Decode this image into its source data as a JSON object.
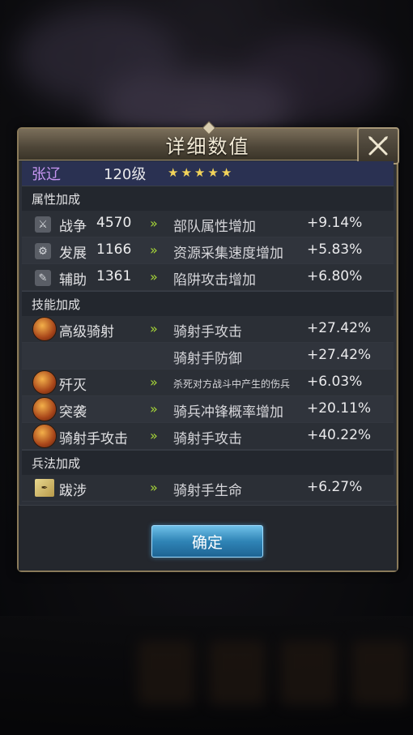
{
  "dialog": {
    "title": "详细数值",
    "confirm_label": "确定"
  },
  "hero": {
    "name": "张辽",
    "level": "120级",
    "stars": [
      "★",
      "★",
      "★",
      "★",
      "★"
    ]
  },
  "attr_section": {
    "title": "属性加成",
    "rows": [
      {
        "icon": "sword-icon",
        "label": "战争",
        "value": "4570",
        "desc": "部队属性增加",
        "pct": "+9.14%"
      },
      {
        "icon": "develop-icon",
        "label": "发展",
        "value": "1166",
        "desc": "资源采集速度增加",
        "pct": "+5.83%"
      },
      {
        "icon": "assist-icon",
        "label": "辅助",
        "value": "1361",
        "desc": "陷阱攻击增加",
        "pct": "+6.80%"
      }
    ]
  },
  "skill_section": {
    "title": "技能加成",
    "rows": [
      {
        "icon": "cavalry-archery-skill-icon",
        "label": "高级骑射",
        "desc": "骑射手攻击",
        "pct": "+27.42%"
      },
      {
        "icon": "",
        "label": "",
        "desc": "骑射手防御",
        "pct": "+27.42%"
      },
      {
        "icon": "annihilate-skill-icon",
        "label": "歼灭",
        "desc": "杀死对方战斗中产生的伤兵",
        "pct": "+6.03%"
      },
      {
        "icon": "raid-skill-icon",
        "label": "突袭",
        "desc": "骑兵冲锋概率增加",
        "pct": "+20.11%"
      },
      {
        "icon": "archer-attack-skill-icon",
        "label": "骑射手攻击",
        "desc": "骑射手攻击",
        "pct": "+40.22%"
      }
    ]
  },
  "tactics_section": {
    "title": "兵法加成",
    "rows": [
      {
        "icon": "tactic-book-icon",
        "label": "跋涉",
        "desc": "骑射手生命",
        "pct": "+6.27%"
      }
    ]
  },
  "arrow_glyph": "»"
}
